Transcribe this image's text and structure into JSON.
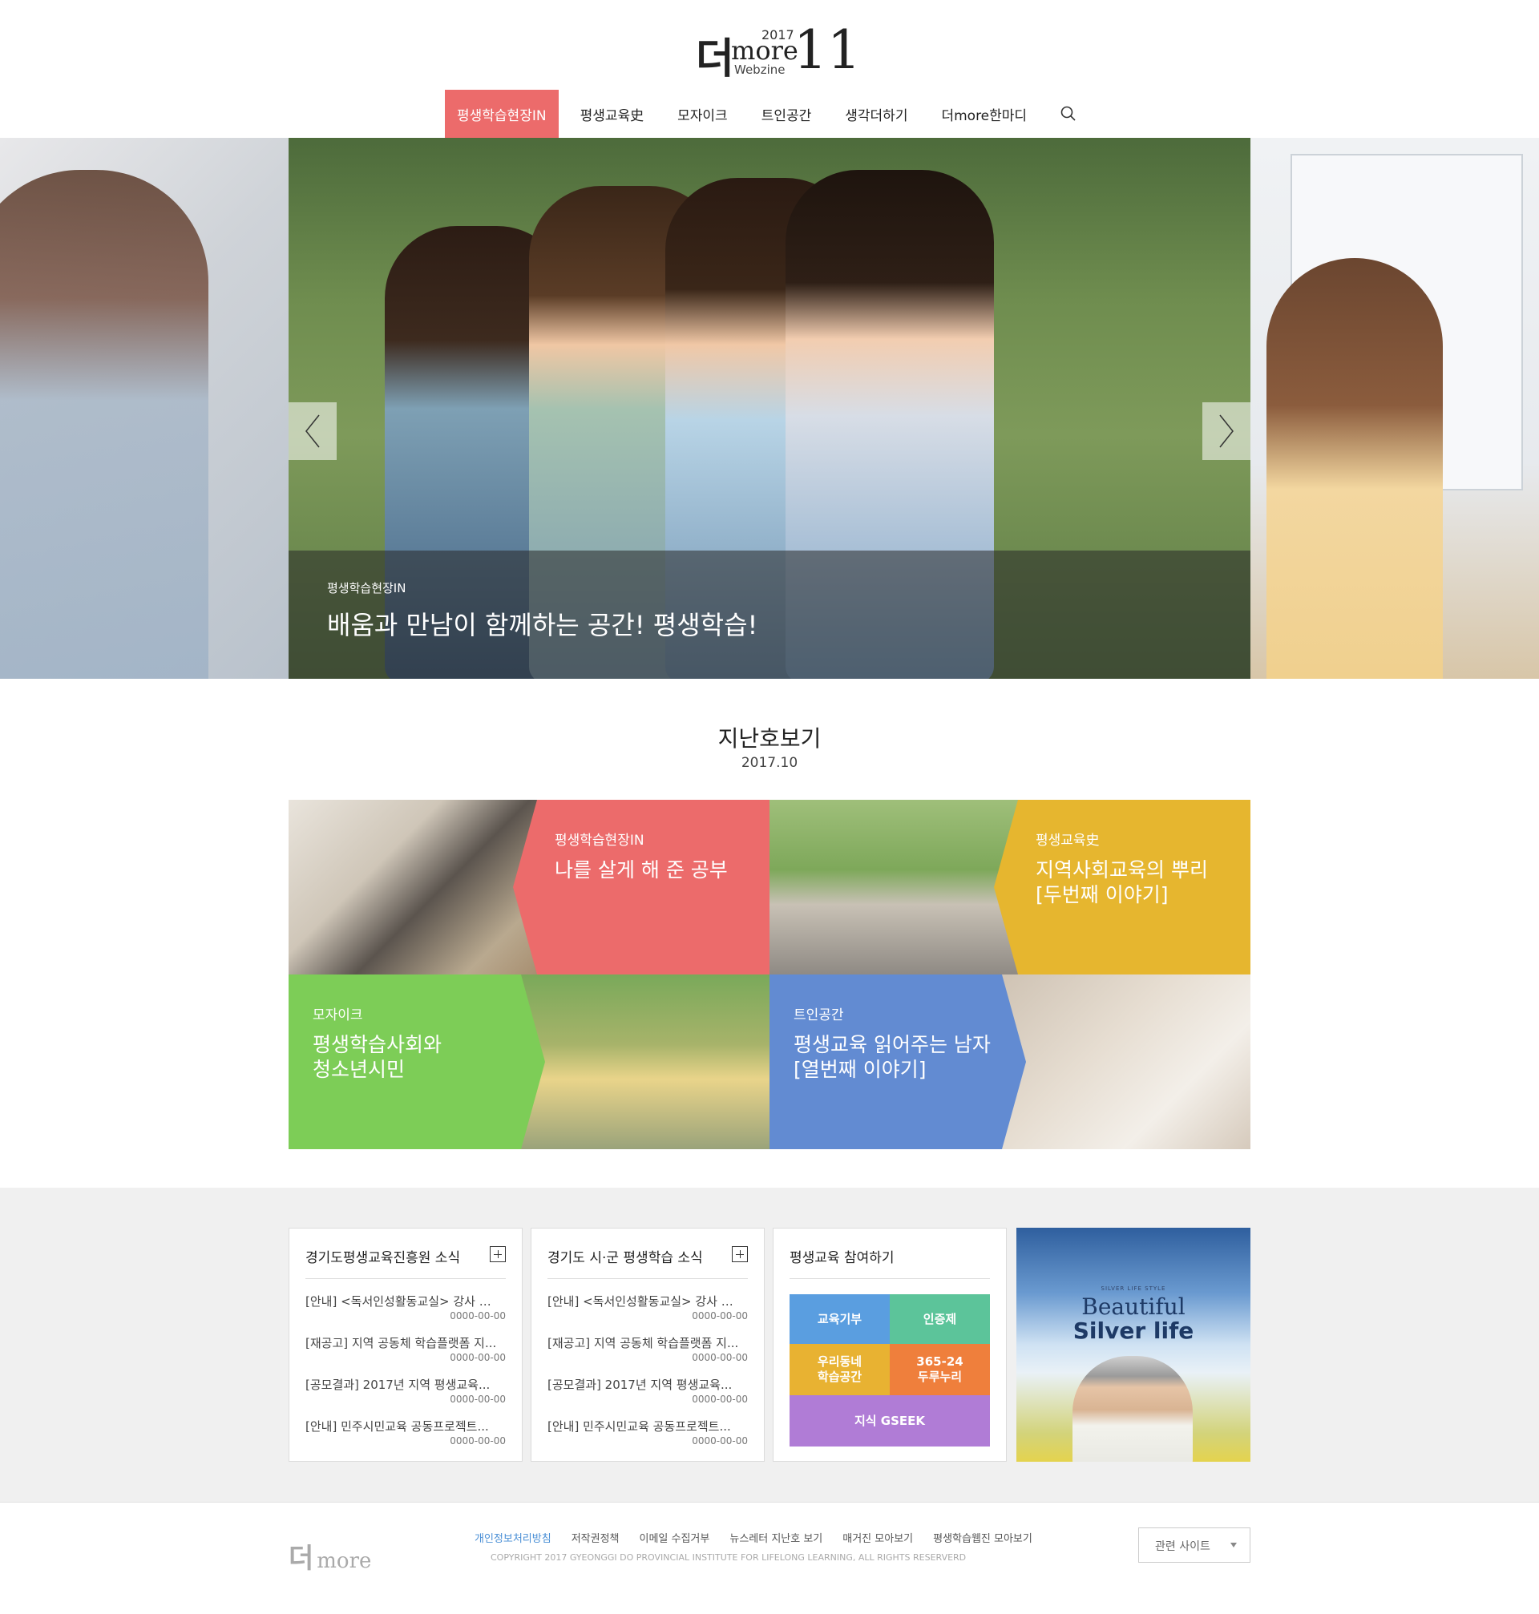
{
  "header": {
    "logo_ko": "더",
    "logo_year": "2017",
    "logo_more": "more",
    "logo_webzine": "Webzine",
    "logo_issue": "11"
  },
  "nav": {
    "items": [
      {
        "label": "평생학습현장IN",
        "active": true
      },
      {
        "label": "평생교육史",
        "active": false
      },
      {
        "label": "모자이크",
        "active": false
      },
      {
        "label": "트인공간",
        "active": false
      },
      {
        "label": "생각더하기",
        "active": false
      },
      {
        "label": "더more한마디",
        "active": false
      }
    ],
    "search_icon": "search-icon",
    "active_color": "#ec6b6b"
  },
  "hero": {
    "category": "평생학습현장IN",
    "headline": "배움과 만남이 함께하는 공간! 평생학습!",
    "prev_icon": "chevron-left-icon",
    "next_icon": "chevron-right-icon"
  },
  "back_issue": {
    "title": "지난호보기",
    "date": "2017.10",
    "tiles": [
      {
        "category": "평생학습현장IN",
        "title": "나를 살게 해 준 공부",
        "color": "#ec6b6b"
      },
      {
        "category": "평생교육史",
        "title": "지역사회교육의 뿌리\n[두번째 이야기]",
        "color": "#e6b62f"
      },
      {
        "category": "모자이크",
        "title": "평생학습사회와\n청소년시민",
        "color": "#7dcd57"
      },
      {
        "category": "트인공간",
        "title": "평생교육 읽어주는 남자\n[열번째 이야기]",
        "color": "#628bd2"
      }
    ]
  },
  "news_cards": [
    {
      "title": "경기도평생교육진흥원 소식",
      "items": [
        {
          "text": "[안내] <독서인성활동교실> 강사 모...",
          "date": "0000-00-00"
        },
        {
          "text": "[재공고] 지역 공동체 학습플랫폼 지...",
          "date": "0000-00-00"
        },
        {
          "text": "[공모결과] 2017년 지역 평생교육...",
          "date": "0000-00-00"
        },
        {
          "text": "[안내] 민주시민교육 공동프로젝트...",
          "date": "0000-00-00"
        }
      ]
    },
    {
      "title": "경기도 시·군 평생학습 소식",
      "items": [
        {
          "text": "[안내] <독서인성활동교실> 강사 모...",
          "date": "0000-00-00"
        },
        {
          "text": "[재공고] 지역 공동체 학습플랫폼 지...",
          "date": "0000-00-00"
        },
        {
          "text": "[공모결과] 2017년 지역 평생교육...",
          "date": "0000-00-00"
        },
        {
          "text": "[안내] 민주시민교육 공동프로젝트...",
          "date": "0000-00-00"
        }
      ]
    }
  ],
  "participate": {
    "title": "평생교육 참여하기",
    "buttons": [
      {
        "label": "교육기부",
        "color": "#5a9ee0"
      },
      {
        "label": "인증제",
        "color": "#5cc49a"
      },
      {
        "label": "우리동네\n학습공간",
        "color": "#e8b232"
      },
      {
        "label": "365-24\n두루누리",
        "color": "#ef7f3c"
      },
      {
        "label": "지식 GSEEK",
        "color": "#b07cd6"
      }
    ]
  },
  "banner": {
    "sub": "SILVER LIFE STYLE",
    "line1": "Beautiful",
    "line2": "Silver life"
  },
  "footer": {
    "logo_ko": "더",
    "logo_more": "more",
    "links": [
      {
        "label": "개인정보처리방침",
        "highlight": true
      },
      {
        "label": "저작권정책",
        "highlight": false
      },
      {
        "label": "이메일 수집거부",
        "highlight": false
      },
      {
        "label": "뉴스레터 지난호 보기",
        "highlight": false
      },
      {
        "label": "매거진 모아보기",
        "highlight": false
      },
      {
        "label": "평생학습웹진 모아보기",
        "highlight": false
      }
    ],
    "copyright": "COPYRIGHT 2017 GYEONGGI DO PROVINCIAL INSTITUTE FOR LIFELONG LEARNING, ALL RIGHTS RESERVERD",
    "related_label": "관련 사이트"
  }
}
